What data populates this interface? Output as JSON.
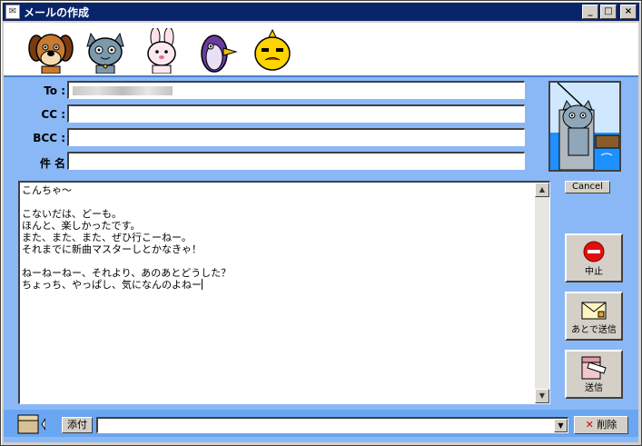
{
  "window": {
    "title": "メールの作成",
    "min_label": "_",
    "max_label": "□",
    "close_label": "×"
  },
  "fields": {
    "to_label": "To :",
    "to_value": "",
    "cc_label": "CC :",
    "cc_value": "",
    "bcc_label": "BCC :",
    "bcc_value": "",
    "subject_label": "件 名",
    "subject_value": ""
  },
  "avatar": {
    "cancel_label": "Cancel"
  },
  "body": {
    "text": "こんちゃ～\n\nこないだは、どーも。\nほんと、楽しかったです。\nまた、また、また、ぜひ行こーねー。\nそれまでに新曲マスターしとかなきゃ！\n\nねーねーねー、それより、あのあとどうした？\nちょっち、やっぱし、気になんのよねー"
  },
  "actions": {
    "stop_label": "中止",
    "later_label": "あとで送信",
    "send_label": "送信"
  },
  "attachments": {
    "attach_label": "添付",
    "value": "",
    "delete_label": "削除"
  },
  "icons": [
    "app-icon",
    "dog-icon",
    "cat-icon",
    "rabbit-icon",
    "penguin-icon",
    "yellow-face-icon",
    "stop-icon",
    "envelope-later-icon",
    "send-box-icon",
    "attach-box-icon",
    "delete-x-icon"
  ],
  "colors": {
    "client_bg": "#6aa6f2",
    "panel_bg": "#8ab8f7",
    "title_bar": "#0a246a",
    "stop_red": "#e01010"
  }
}
